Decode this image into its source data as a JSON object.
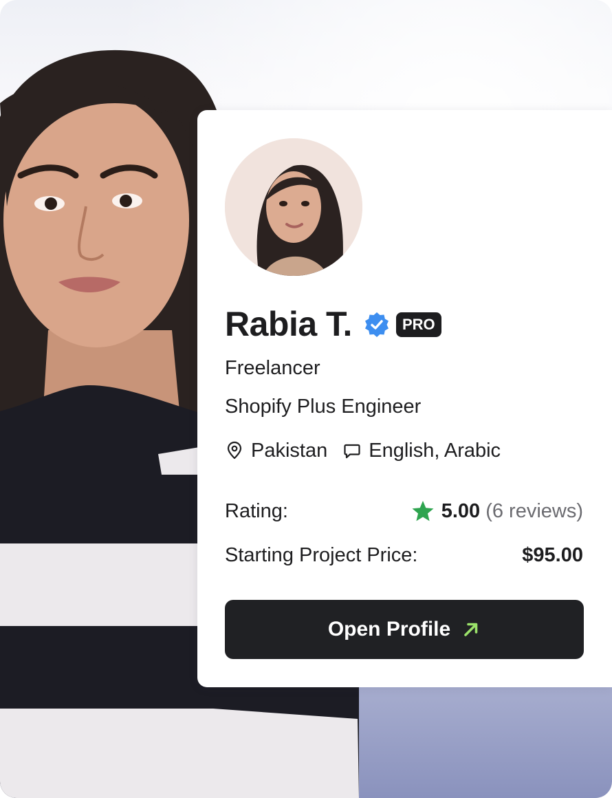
{
  "profile": {
    "name": "Rabia T.",
    "badge": "PRO",
    "role": "Freelancer",
    "title": "Shopify Plus Engineer",
    "location": "Pakistan",
    "languages": "English, Arabic"
  },
  "stats": {
    "rating_label": "Rating:",
    "rating_value": "5.00",
    "reviews": "(6 reviews)",
    "price_label": "Starting Project Price:",
    "price_value": "$95.00"
  },
  "cta": {
    "label": "Open Profile"
  },
  "colors": {
    "verified": "#3d8ef0",
    "star": "#2ea44f",
    "arrow": "#9be26a",
    "button": "#202124"
  },
  "icons": [
    "verified-badge-icon",
    "location-pin-icon",
    "chat-bubble-icon",
    "star-icon",
    "arrow-up-right-icon"
  ]
}
